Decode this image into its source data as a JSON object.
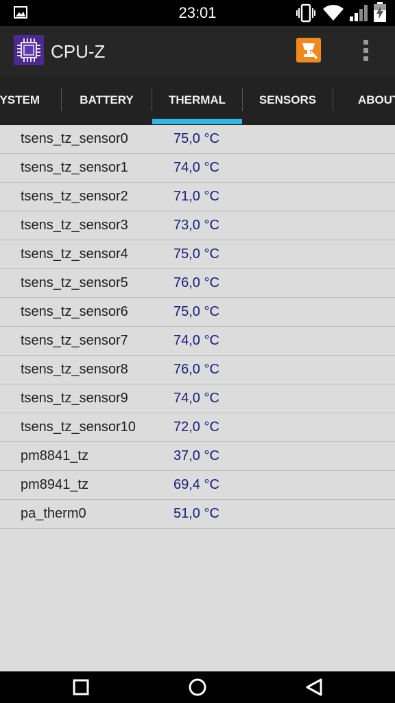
{
  "status_bar": {
    "time": "23:01",
    "icons": [
      "image-notification-icon",
      "vibrate-icon",
      "wifi-icon",
      "signal-icon",
      "battery-charging-icon"
    ]
  },
  "app_bar": {
    "title": "CPU-Z",
    "logo_icon": "cpu-chip-icon",
    "actions": [
      "validate-trophy-icon",
      "overflow-menu-icon"
    ]
  },
  "tabs": [
    {
      "label": "SYSTEM",
      "visible_label": "YSTEM",
      "active": false
    },
    {
      "label": "BATTERY",
      "active": false
    },
    {
      "label": "THERMAL",
      "active": true
    },
    {
      "label": "SENSORS",
      "active": false
    },
    {
      "label": "ABOUT",
      "visible_label": "ABOUT",
      "active": false
    }
  ],
  "thermal": {
    "rows": [
      {
        "name": "tsens_tz_sensor0",
        "value": "75,0 °C"
      },
      {
        "name": "tsens_tz_sensor1",
        "value": "74,0 °C"
      },
      {
        "name": "tsens_tz_sensor2",
        "value": "71,0 °C"
      },
      {
        "name": "tsens_tz_sensor3",
        "value": "73,0 °C"
      },
      {
        "name": "tsens_tz_sensor4",
        "value": "75,0 °C"
      },
      {
        "name": "tsens_tz_sensor5",
        "value": "76,0 °C"
      },
      {
        "name": "tsens_tz_sensor6",
        "value": "75,0 °C"
      },
      {
        "name": "tsens_tz_sensor7",
        "value": "74,0 °C"
      },
      {
        "name": "tsens_tz_sensor8",
        "value": "76,0 °C"
      },
      {
        "name": "tsens_tz_sensor9",
        "value": "74,0 °C"
      },
      {
        "name": "tsens_tz_sensor10",
        "value": "72,0 °C"
      },
      {
        "name": "pm8841_tz",
        "value": "37,0 °C"
      },
      {
        "name": "pm8941_tz",
        "value": "69,4 °C"
      },
      {
        "name": "pa_therm0",
        "value": "51,0 °C"
      }
    ]
  },
  "nav_bar": {
    "icons": [
      "recents-square-icon",
      "home-circle-icon",
      "back-triangle-icon"
    ]
  },
  "colors": {
    "accent": "#33b5e5",
    "value_text": "#1a1a7a",
    "background": "#dcdcdc",
    "validate_button": "#f08a1d"
  }
}
